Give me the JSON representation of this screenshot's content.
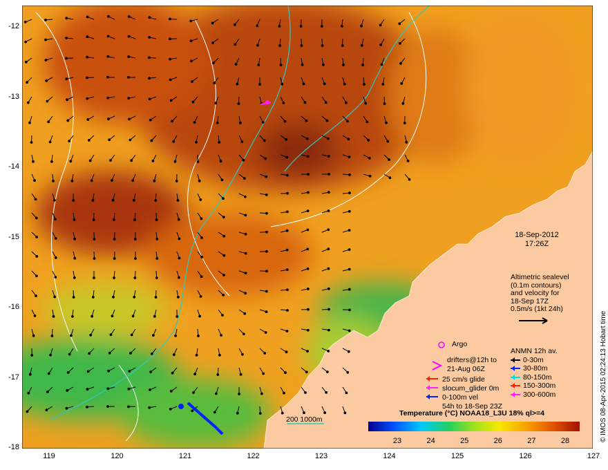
{
  "map": {
    "lat_ticks": [
      "-12",
      "-13",
      "-14",
      "-15",
      "-16",
      "-17",
      "-18"
    ],
    "lon_ticks": [
      "119",
      "120",
      "121",
      "122",
      "123",
      "124",
      "125",
      "126",
      "127"
    ],
    "colors": {
      "warm": "#e06a10",
      "hot": "#b23a06",
      "mid": "#f0a020",
      "cool_green": "#3fb848",
      "yellow_green": "#b0d030",
      "land": "#fbcaa0",
      "isobath": "#30c8c0",
      "contour": "#ffffff"
    }
  },
  "annotations": {
    "date": "18-Sep-2012",
    "time": "17:26Z",
    "altimetry_lines": [
      "Altimetric sealevel",
      "(0.1m contours)",
      "and velocity for",
      "18-Sep 17Z",
      "0.5m/s (1kt 24h)"
    ],
    "argo_label": "Argo",
    "drifters_lines": [
      "drifters@12h to",
      "21-Aug 06Z"
    ],
    "glider_25": "25 cm/s glide",
    "slocum": "slocum_glider 0m",
    "vel_lines": [
      "0-100m vel",
      "54h to 18-Sep 23Z"
    ],
    "anmn_title": "ANMN 12h av.",
    "anmn_items": [
      {
        "label": "0-30m",
        "color": "#000000"
      },
      {
        "label": "30-80m",
        "color": "#0020ff"
      },
      {
        "label": "80-150m",
        "color": "#00e0e0"
      },
      {
        "label": "150-300m",
        "color": "#ff2000"
      },
      {
        "label": "300-600m",
        "color": "#ff20ff"
      }
    ],
    "isobath_legend": "200  1000m"
  },
  "colorbar": {
    "title": "Temperature (°C) NOAA18_L3U 18% ql>=4",
    "ticks": [
      "23",
      "24",
      "25",
      "26",
      "27",
      "28"
    ]
  },
  "credit": "© IMOS 08-Apr-2015 02:24:13 Hobart time"
}
